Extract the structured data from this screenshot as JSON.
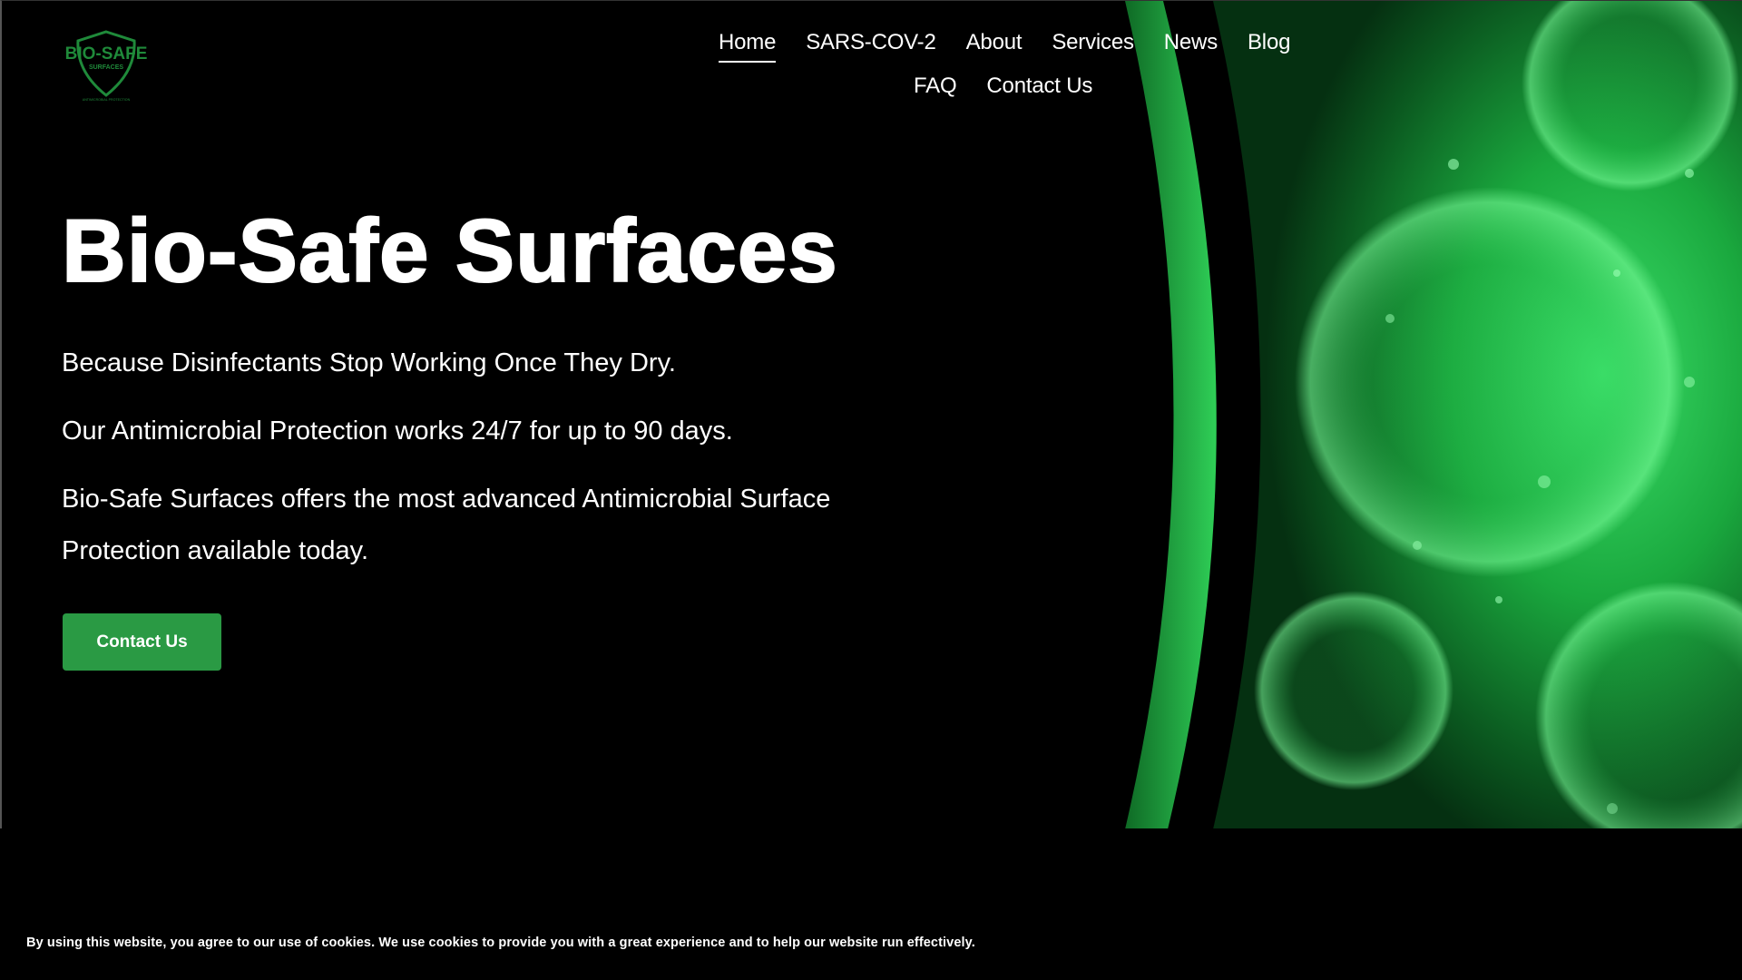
{
  "brand": {
    "logo_text_line1": "BIO-SAFE",
    "logo_text_line2": "SURFACES",
    "logo_tagline": "ANTIMICROBIAL PROTECTION",
    "logo_color": "#1f8a3a"
  },
  "nav": {
    "row1": [
      "Home",
      "SARS-COV-2",
      "About",
      "Services",
      "News",
      "Blog"
    ],
    "row2": [
      "FAQ",
      "Contact Us"
    ],
    "active": "Home"
  },
  "hero": {
    "title": "Bio-Safe Surfaces",
    "line1": "Because Disinfectants Stop Working Once They Dry.",
    "line2": "Our Antimicrobial Protection works 24/7 for up to 90 days.",
    "line3": "Bio-Safe Surfaces offers the most advanced Antimicrobial Surface Protection available today.",
    "cta_label": "Contact Us",
    "accent": "#2a9a44",
    "art_green": "#33e060"
  },
  "cookie_notice": "By using this website, you agree to our use of cookies. We use cookies to provide you with a great experience and to help our website run effectively."
}
